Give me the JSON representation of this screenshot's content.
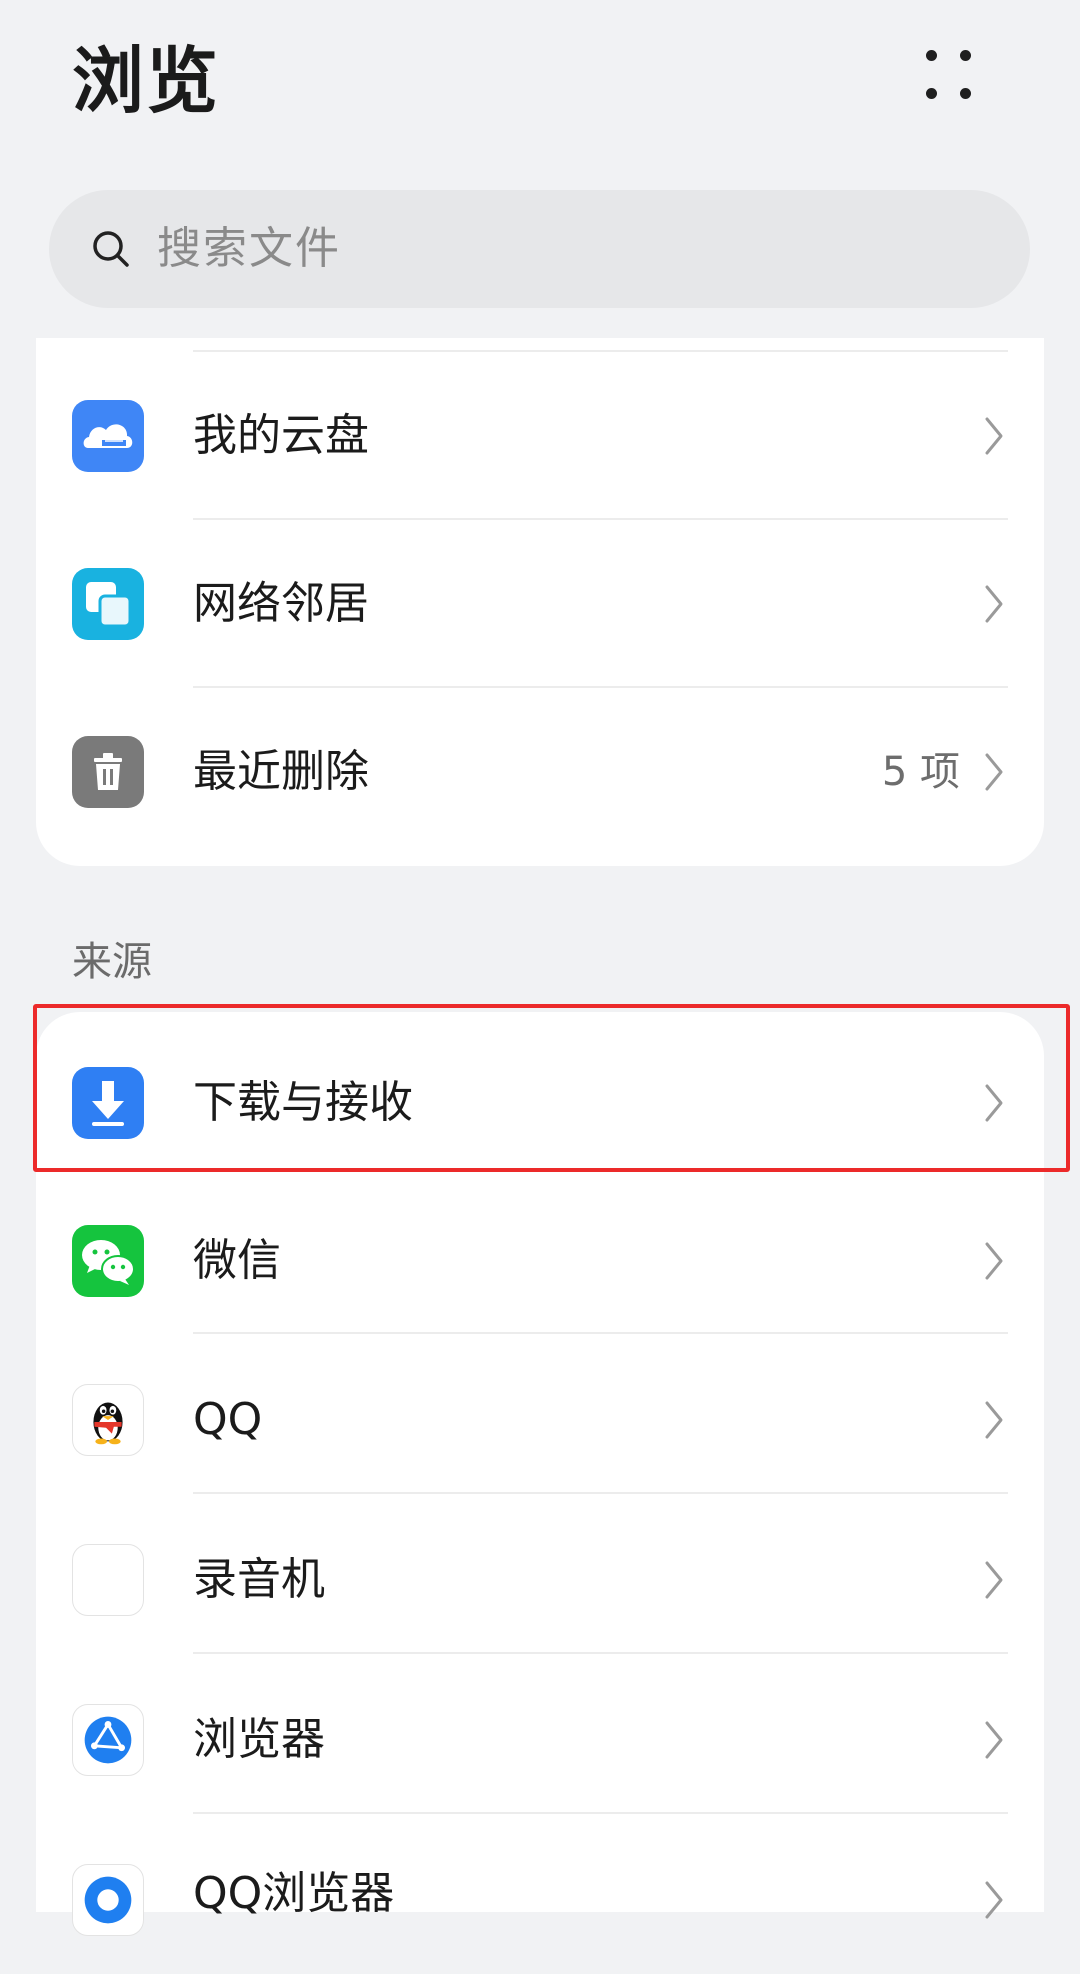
{
  "header": {
    "title": "浏览",
    "more_icon": "more-dots-icon"
  },
  "search": {
    "placeholder": "搜索文件",
    "icon": "search-icon"
  },
  "locations": {
    "items": [
      {
        "label": "我的云盘",
        "icon": "cloud-drive-icon",
        "icon_color": "#3f86f6"
      },
      {
        "label": "网络邻居",
        "icon": "network-neighbor-icon",
        "icon_color": "#19b2e0"
      },
      {
        "label": "最近删除",
        "icon": "trash-icon",
        "icon_color": "#7a7a7a",
        "count": "5 项"
      }
    ]
  },
  "sources": {
    "section_label": "来源",
    "items": [
      {
        "label": "下载与接收",
        "icon": "download-icon",
        "icon_color": "#2f7ff3",
        "highlighted": true
      },
      {
        "label": "微信",
        "icon": "wechat-icon",
        "icon_color": "#15c43e"
      },
      {
        "label": "QQ",
        "icon": "qq-icon"
      },
      {
        "label": "录音机",
        "icon": "recorder-icon"
      },
      {
        "label": "浏览器",
        "icon": "browser-icon",
        "icon_color": "#1f7ff0"
      },
      {
        "label": "QQ浏览器",
        "icon": "qq-browser-icon",
        "icon_color": "#1f7ff0"
      }
    ]
  },
  "colors": {
    "highlight": "#ec2a2a",
    "background": "#f1f2f4"
  }
}
